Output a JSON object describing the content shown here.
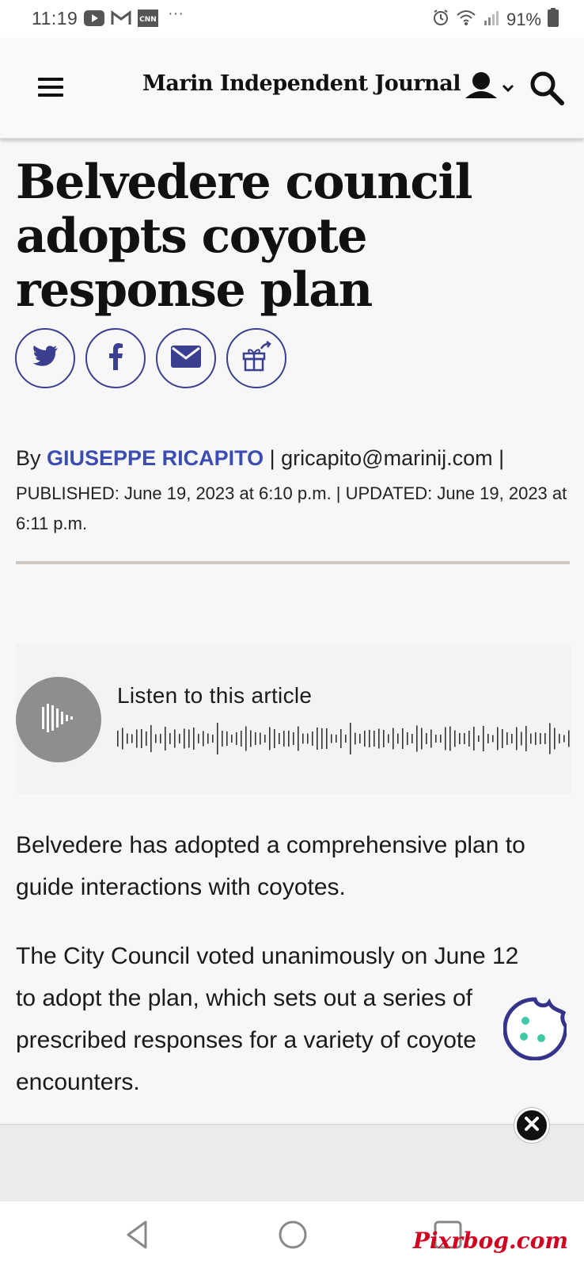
{
  "status_bar": {
    "time": "11:19",
    "left_icons": [
      "youtube-icon",
      "gmail-icon",
      "cnn-icon"
    ],
    "more": "···",
    "battery": "91%",
    "right_icons": [
      "alarm-icon",
      "wifi-icon",
      "signal-icon",
      "battery-icon"
    ]
  },
  "header": {
    "masthead": "Marin Independent Journal",
    "menu_icon": "hamburger-menu-icon",
    "user_icon": "user-icon",
    "search_icon": "search-icon"
  },
  "article": {
    "headline": "Belvedere council adopts coyote response plan",
    "share_buttons": [
      "twitter-icon",
      "facebook-icon",
      "email-icon",
      "gift-icon"
    ],
    "by_prefix": "By",
    "author": "GIUSEPPE RICAPITO",
    "author_email": " | gricapito@marinij.com |",
    "dateline": "PUBLISHED: June 19, 2023 at 6:10 p.m. | UPDATED: June 19, 2023 at 6:11 p.m.",
    "audio_label": "Listen to this article",
    "paragraphs": [
      "Belvedere has adopted a comprehensive plan to guide interactions with coyotes.",
      "The City Council voted unanimously on June 12 to adopt the plan, which sets out a series of prescribed responses for a variety of coyote encounters."
    ]
  },
  "colors": {
    "accent": "#3b3f8f",
    "author_link": "#3c4db2",
    "cookie_dots": "#3ec8a6"
  },
  "watermark": "Pixrbog.com"
}
